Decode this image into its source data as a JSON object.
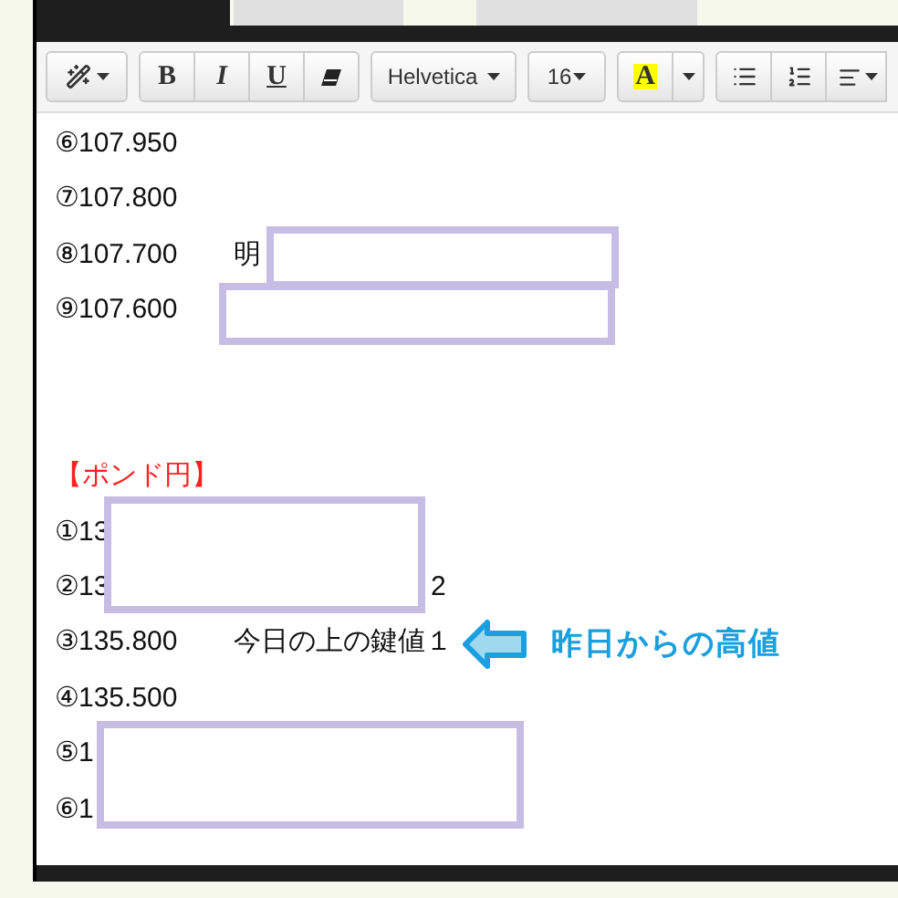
{
  "toolbar": {
    "format_buttons": [
      "B",
      "I",
      "U"
    ],
    "font": "Helvetica",
    "size": "16",
    "color_button": "A"
  },
  "lines": [
    {
      "number": "⑥107.950"
    },
    {
      "number": "⑦107.800"
    },
    {
      "number": "⑧107.700",
      "note": "明"
    },
    {
      "number": "⑨107.600"
    }
  ],
  "section_heading": "【ポンド円】",
  "pound_lines": [
    {
      "number": "①13"
    },
    {
      "number": "②13",
      "tail": "2"
    },
    {
      "number": "③135.800",
      "note": "今日の上の鍵値１",
      "callout": "昨日からの高値"
    },
    {
      "number": "④135.500"
    },
    {
      "number": "⑤1"
    },
    {
      "number": "⑥1"
    }
  ]
}
